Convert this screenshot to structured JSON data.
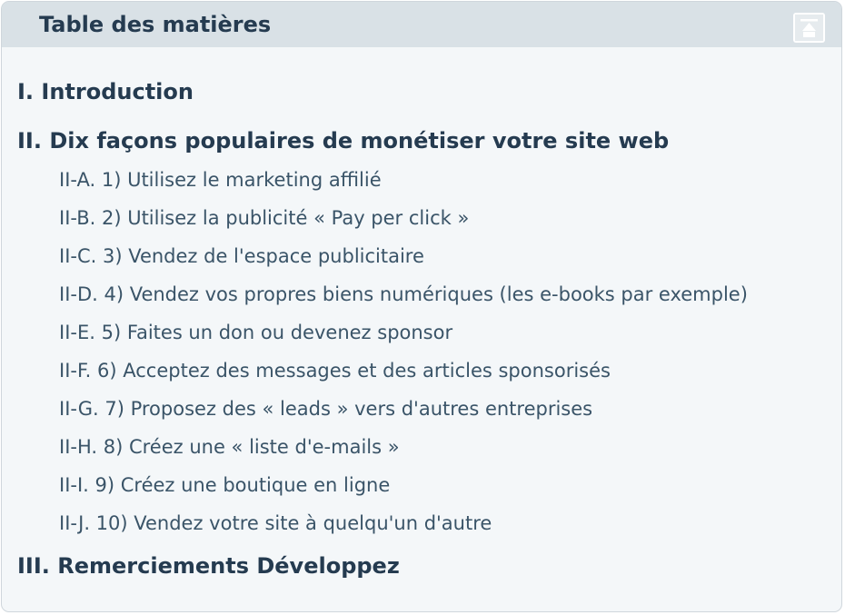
{
  "toc": {
    "title": "Table des matières",
    "collapse_icon": "collapse-up-icon",
    "sections": [
      {
        "label": "I. Introduction",
        "subsections": []
      },
      {
        "label": "II. Dix façons populaires de monétiser votre site web",
        "subsections": [
          "II-A. 1) Utilisez le marketing affilié",
          "II-B. 2) Utilisez la publicité « Pay per click »",
          "II-C. 3) Vendez de l'espace publicitaire",
          "II-D. 4) Vendez vos propres biens numériques (les e-books par exemple)",
          "II-E. 5) Faites un don ou devenez sponsor",
          "II-F. 6) Acceptez des messages et des articles sponsorisés",
          "II-G. 7) Proposez des « leads » vers d'autres entreprises",
          "II-H. 8) Créez une « liste d'e-mails »",
          "II-I. 9) Créez une boutique en ligne",
          "II-J. 10) Vendez votre site à quelqu'un d'autre"
        ]
      },
      {
        "label": "III. Remerciements Développez",
        "subsections": []
      }
    ]
  },
  "colors": {
    "header_bg": "#d9e1e6",
    "body_bg": "#f4f7f9",
    "heading_text": "#253b50",
    "link_text": "#3a5468"
  }
}
